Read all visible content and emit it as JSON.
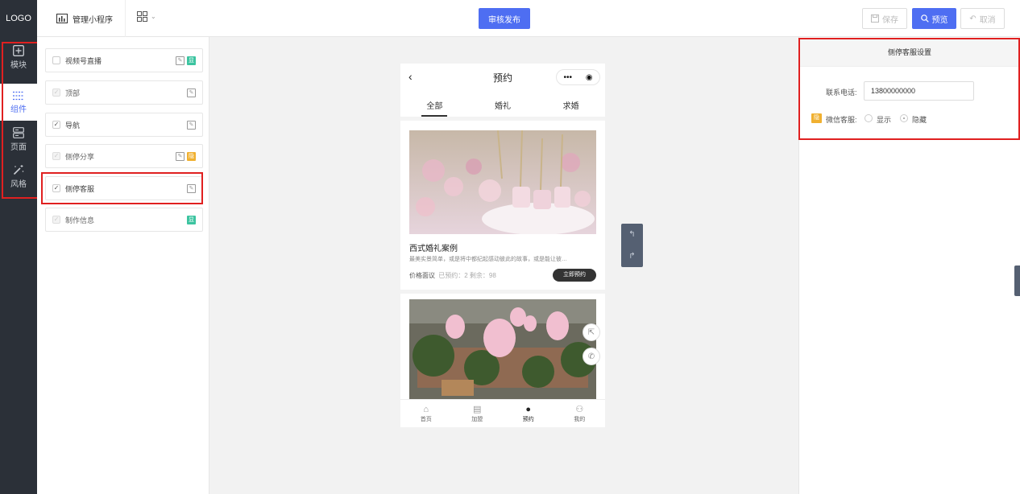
{
  "topbar": {
    "logo": "LOGO",
    "app_tab_label": "管理小程序",
    "publish_label": "审核发布",
    "save_label": "保存",
    "preview_label": "预览",
    "cancel_label": "取消"
  },
  "leftnav": {
    "items": [
      {
        "label": "模块",
        "icon": "plus-square-icon"
      },
      {
        "label": "组件",
        "icon": "components-icon"
      },
      {
        "label": "页面",
        "icon": "pages-icon"
      },
      {
        "label": "风格",
        "icon": "magic-wand-icon"
      }
    ],
    "active_index": 1
  },
  "components": [
    {
      "label": "视频号直播",
      "checked": false,
      "disabled": false,
      "badge": "显"
    },
    {
      "label": "顶部",
      "checked": true,
      "disabled": true,
      "badge": ""
    },
    {
      "label": "导航",
      "checked": true,
      "disabled": false,
      "badge": ""
    },
    {
      "label": "侧停分享",
      "checked": true,
      "disabled": true,
      "badge": "隐"
    },
    {
      "label": "侧停客服",
      "checked": true,
      "disabled": false,
      "badge": ""
    },
    {
      "label": "制作信息",
      "checked": true,
      "disabled": true,
      "badge": "显"
    }
  ],
  "phone": {
    "title": "预约",
    "capsule_more": "•••",
    "capsule_close": "◉",
    "tabs": [
      "全部",
      "婚礼",
      "求婚"
    ],
    "active_tab": 0,
    "card": {
      "title": "西式婚礼案例",
      "desc": "最美实景简单，或是将中都纪起感动彼此的故事，或是能让彼…",
      "price": "价格面议",
      "stats": "已预约：2 剩余：98",
      "button": "立即预约"
    },
    "tabbar": [
      {
        "label": "首页",
        "icon": "home-icon"
      },
      {
        "label": "加盟",
        "icon": "document-icon"
      },
      {
        "label": "预约",
        "icon": "clock-icon"
      },
      {
        "label": "我的",
        "icon": "user-icon"
      }
    ],
    "tabbar_active": 2
  },
  "settings": {
    "title": "侧停客服设置",
    "phone_label": "联系电话:",
    "phone_value": "13800000000",
    "wechat_badge": "隐",
    "wechat_label": "微信客服:",
    "show_option": "显示",
    "hide_option": "隐藏",
    "selected": "隐藏"
  },
  "colors": {
    "accent": "#4e6ef2",
    "nav_bg": "#2b3038",
    "highlight": "#e02020",
    "badge_green": "#3cc4a0",
    "badge_orange": "#f0b030"
  }
}
